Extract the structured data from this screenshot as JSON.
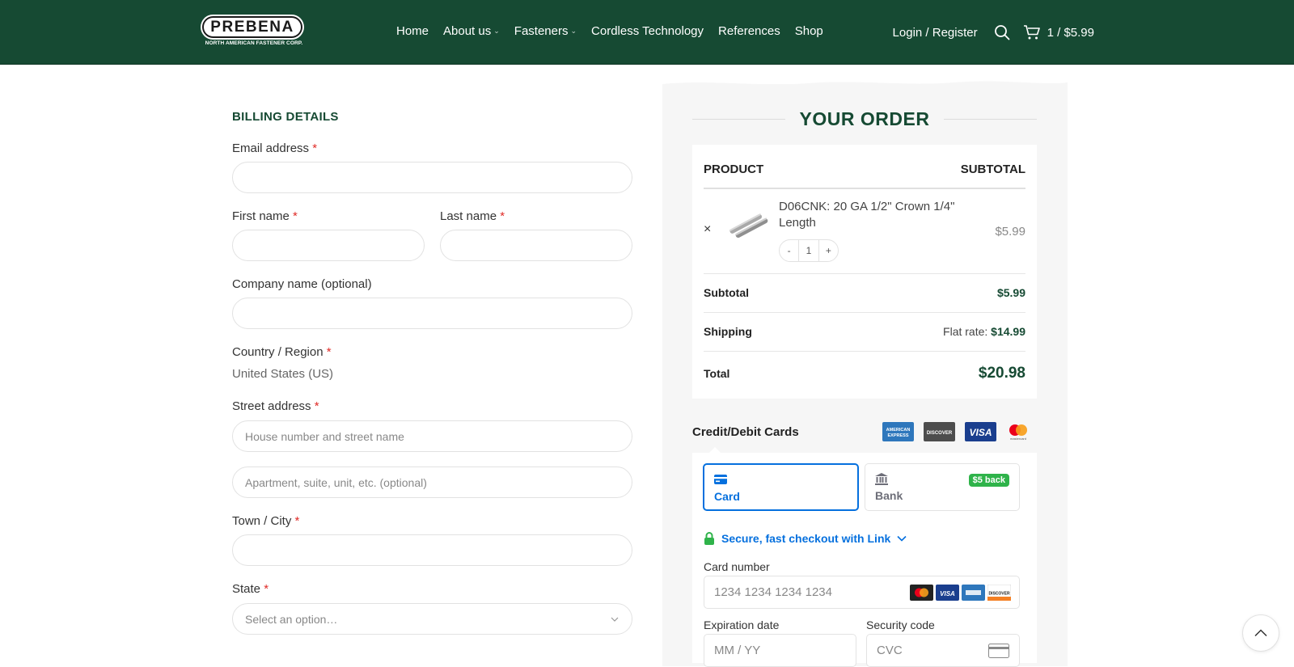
{
  "header": {
    "logo_text": "PREBENA",
    "logo_subtext": "NORTH AMERICAN FASTENER CORP.",
    "nav": [
      {
        "label": "Home",
        "has_dropdown": false
      },
      {
        "label": "About us",
        "has_dropdown": true
      },
      {
        "label": "Fasteners",
        "has_dropdown": true
      },
      {
        "label": "Cordless Technology",
        "has_dropdown": false
      },
      {
        "label": "References",
        "has_dropdown": false
      },
      {
        "label": "Shop",
        "has_dropdown": false
      }
    ],
    "login_label": "Login / Register",
    "cart_summary": "1 / $5.99",
    "icons": {
      "search": "search-icon",
      "cart": "cart-icon"
    }
  },
  "billing": {
    "title": "BILLING DETAILS",
    "email_label": "Email address",
    "first_name_label": "First name",
    "last_name_label": "Last name",
    "company_label": "Company name (optional)",
    "country_label": "Country / Region",
    "country_value": "United States (US)",
    "street_label": "Street address",
    "street1_placeholder": "House number and street name",
    "street2_placeholder": "Apartment, suite, unit, etc. (optional)",
    "city_label": "Town / City",
    "state_label": "State",
    "state_placeholder": "Select an option…",
    "required_mark": "*"
  },
  "order": {
    "title": "YOUR ORDER",
    "col_product": "PRODUCT",
    "col_subtotal": "SUBTOTAL",
    "item": {
      "name": "D06CNK: 20 GA 1/2\" Crown 1/4\" Length",
      "qty": "1",
      "qty_minus": "-",
      "qty_plus": "+",
      "price": "$5.99",
      "remove": "×"
    },
    "subtotal_label": "Subtotal",
    "subtotal_value": "$5.99",
    "shipping_label": "Shipping",
    "shipping_prefix": "Flat rate:",
    "shipping_value": "$14.99",
    "total_label": "Total",
    "total_value": "$20.98"
  },
  "payment": {
    "title": "Credit/Debit Cards",
    "brands": [
      "American Express",
      "Discover",
      "Visa",
      "Mastercard"
    ],
    "tab_card": "Card",
    "tab_bank": "Bank",
    "bank_badge": "$5 back",
    "link_text": "Secure, fast checkout with Link",
    "card_number_label": "Card number",
    "card_number_placeholder": "1234 1234 1234 1234",
    "expiry_label": "Expiration date",
    "expiry_placeholder": "MM / YY",
    "cvc_label": "Security code",
    "cvc_placeholder": "CVC"
  },
  "colors": {
    "brand_green": "#164a33",
    "required_red": "#e02b27",
    "stripe_blue": "#0570de",
    "badge_green": "#2fb34a"
  }
}
